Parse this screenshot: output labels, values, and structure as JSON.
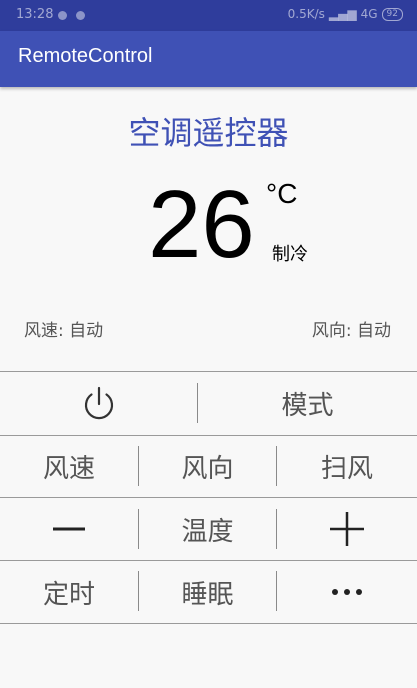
{
  "status_bar": {
    "time": "13:28",
    "network": "0.5K/s",
    "signal": "4G",
    "battery": "92"
  },
  "appbar": {
    "title": "RemoteControl"
  },
  "remote": {
    "heading": "空调遥控器",
    "temperature": "26",
    "unit": "°C",
    "mode": "制冷",
    "fan_speed": "风速: 自动",
    "fan_direction": "风向: 自动"
  },
  "buttons": {
    "power_icon": "power-icon",
    "mode": "模式",
    "fan_speed": "风速",
    "fan_direction": "风向",
    "swing": "扫风",
    "minus_icon": "minus-icon",
    "temperature": "温度",
    "plus_icon": "plus-icon",
    "timer": "定时",
    "sleep": "睡眠",
    "more_icon": "more-icon"
  }
}
